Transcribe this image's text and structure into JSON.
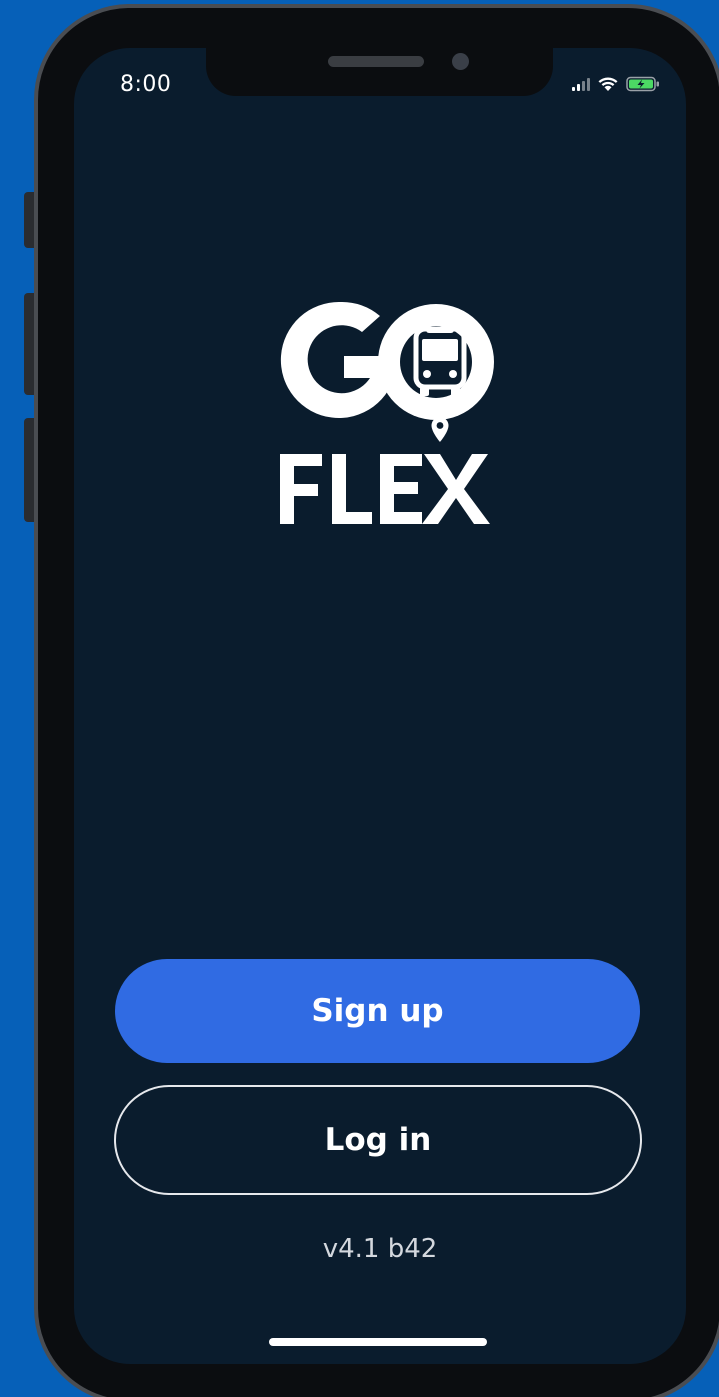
{
  "status_bar": {
    "time": "8:00",
    "icons": [
      "signal-icon",
      "wifi-icon",
      "battery-charging-icon"
    ],
    "battery_color": "#4cd964"
  },
  "logo": {
    "line1": "GO",
    "line2": "FLEX",
    "icons": [
      "bus-icon",
      "map-pin-icon"
    ]
  },
  "actions": {
    "signup_label": "Sign up",
    "login_label": "Log in"
  },
  "footer": {
    "version": "v4.1 b42"
  },
  "colors": {
    "background": "#0660b8",
    "screen": "#0a1c2d",
    "primary_button": "#306be3",
    "text": "#ffffff"
  }
}
